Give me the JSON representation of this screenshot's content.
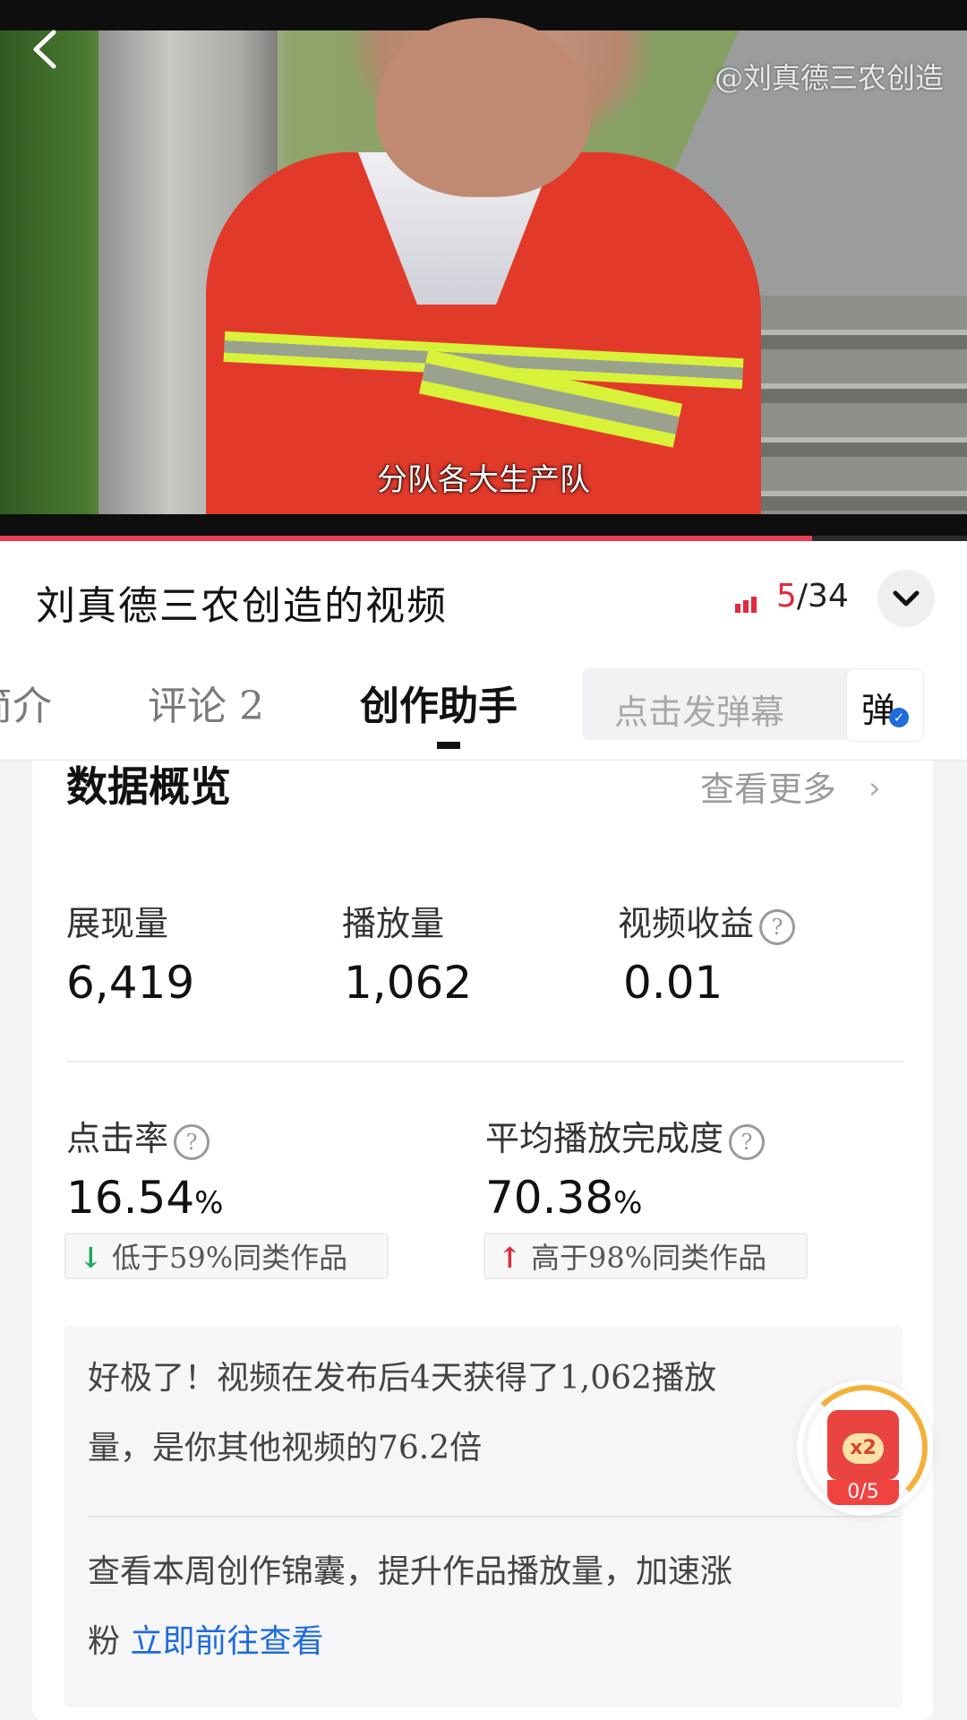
{
  "video": {
    "subtitle": "分队各大生产队",
    "watermark": "@刘真德三农创造",
    "progress": 0.84
  },
  "header": {
    "collection_title": "刘真德三农创造的视频",
    "episode_current": "5",
    "episode_total": "/34"
  },
  "tabs": [
    {
      "label": "简介"
    },
    {
      "label": "评论 2"
    },
    {
      "label": "创作助手"
    }
  ],
  "danmaku": {
    "placeholder": "点击发弹幕",
    "button": "弹"
  },
  "overview": {
    "title": "数据概览",
    "view_more": "查看更多",
    "metrics": [
      {
        "label": "展现量",
        "value": "6,419"
      },
      {
        "label": "播放量",
        "value": "1,062"
      },
      {
        "label": "视频收益",
        "value": "0.01",
        "help": "?"
      }
    ],
    "rates": [
      {
        "label": "点击率",
        "value": "16.54",
        "unit": "%",
        "help": "?",
        "compare_arrow": "↓",
        "compare": "低于59%同类作品"
      },
      {
        "label": "平均播放完成度",
        "value": "70.38",
        "unit": "%",
        "help": "?",
        "compare_arrow": "↑",
        "compare": "高于98%同类作品"
      }
    ]
  },
  "insight": {
    "line1": "好极了！视频在发布后4天获得了1,062播放",
    "line2": "量，是你其他视频的76.2倍",
    "line3": "查看本周创作锦囊，提升作品播放量，加速涨",
    "line4_prefix": "粉 ",
    "link": "立即前往查看"
  },
  "reward": {
    "multiplier": "x2",
    "count": "0/5"
  },
  "colors": {
    "accent_red": "#e5283a",
    "link_blue": "#1e6bdc",
    "up_red": "#e5283a",
    "down_green": "#21a95b"
  }
}
